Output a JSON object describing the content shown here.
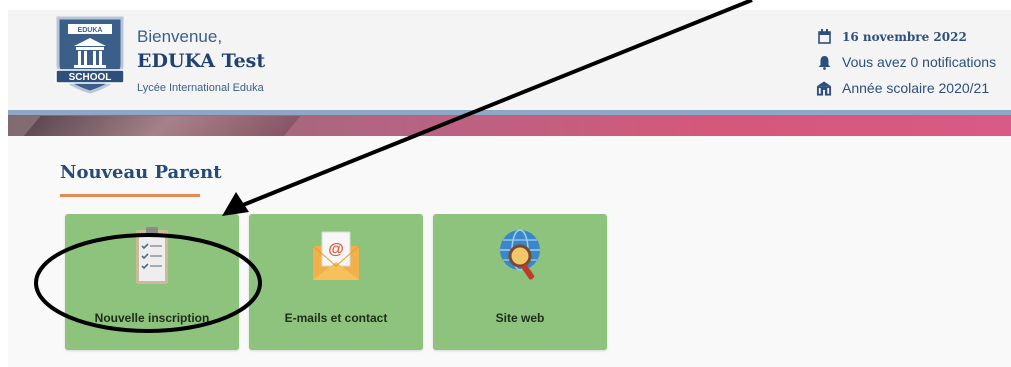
{
  "header": {
    "welcome": "Bienvenue,",
    "username": "EDUKA Test",
    "school_name": "Lycée International Eduka",
    "logo": {
      "top_text": "EDUKA",
      "badge_text": "SCHOOL"
    },
    "date": "16 novembre 2022",
    "notifications": "Vous avez 0 notifications",
    "school_year": "Année scolaire 2020/21",
    "icons": {
      "date": "calendar-icon",
      "notifications": "bell-icon",
      "year": "school-building-icon"
    }
  },
  "section": {
    "title": "Nouveau Parent"
  },
  "tiles": [
    {
      "label": "Nouvelle inscription",
      "icon": "clipboard-checklist-icon"
    },
    {
      "label": "E-mails et contact",
      "icon": "envelope-at-icon"
    },
    {
      "label": "Site web",
      "icon": "globe-magnifier-icon"
    }
  ],
  "colors": {
    "tile_bg": "#8dc37c",
    "title_blue": "#1f4270",
    "underline_orange": "#e58a57",
    "banner_pink": "#d4587a"
  }
}
